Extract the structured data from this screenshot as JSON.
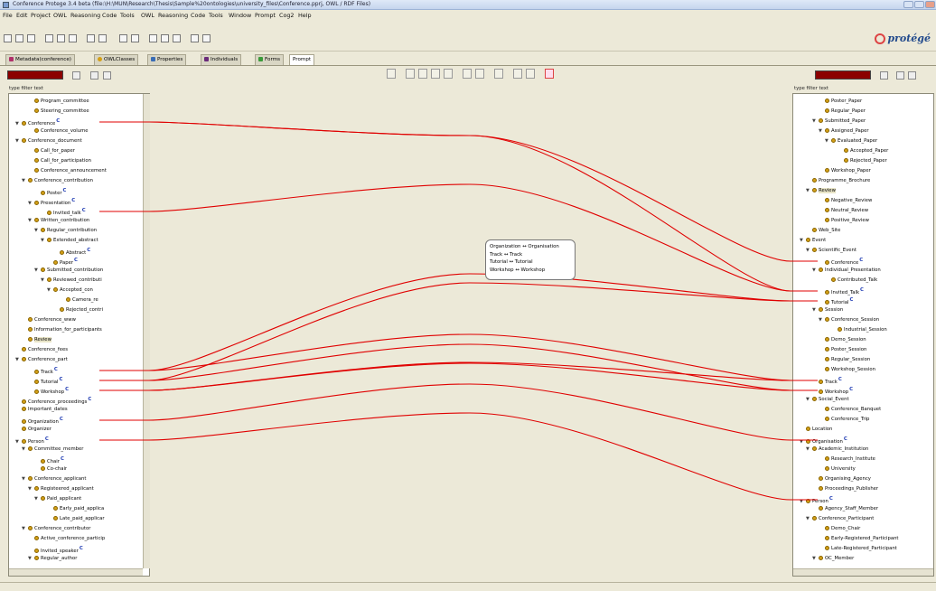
{
  "window": {
    "title": "Conference Protege 3.4 beta   (file:\\H:\\MUN\\Research\\Thesis\\Sample%20ontologies\\university_files\\Conference.pprj, OWL / RDF Files)"
  },
  "menu": [
    "File",
    "Edit",
    "Project",
    "OWL",
    "Reasoning",
    "Code",
    "Tools",
    "OWL",
    "Reasoning",
    "Code",
    "Tools",
    "Window",
    "Prompt",
    "Cog2",
    "Help"
  ],
  "logo": "protégé",
  "tabs": [
    "Metadata(conference)",
    "OWLClasses",
    "Properties",
    "Individuals",
    "Forms",
    "Prompt"
  ],
  "left_panel": {
    "filter_label": "type filter text",
    "rows": [
      {
        "label": "Program_committee",
        "indent": 3,
        "tw": ""
      },
      {
        "label": "Steering_committee",
        "indent": 3,
        "tw": ""
      },
      {
        "label": "Conference",
        "indent": 1,
        "tw": "▼",
        "c": true
      },
      {
        "label": "Conference_volume",
        "indent": 3,
        "tw": ""
      },
      {
        "label": "Conference_document",
        "indent": 1,
        "tw": "▼"
      },
      {
        "label": "Call_for_paper",
        "indent": 3,
        "tw": ""
      },
      {
        "label": "Call_for_participation",
        "indent": 3,
        "tw": ""
      },
      {
        "label": "Conference_announcement",
        "indent": 3,
        "tw": ""
      },
      {
        "label": "Conference_contribution",
        "indent": 2,
        "tw": "▼"
      },
      {
        "label": "Poster",
        "indent": 4,
        "tw": "",
        "c": true
      },
      {
        "label": "Presentation",
        "indent": 3,
        "tw": "▼",
        "c": true
      },
      {
        "label": "Invited_talk",
        "indent": 5,
        "tw": "",
        "c": true
      },
      {
        "label": "Written_contribution",
        "indent": 3,
        "tw": "▼"
      },
      {
        "label": "Regular_contribution",
        "indent": 4,
        "tw": "▼"
      },
      {
        "label": "Extended_abstract",
        "indent": 5,
        "tw": "▼"
      },
      {
        "label": "Abstract",
        "indent": 7,
        "tw": "",
        "c": true
      },
      {
        "label": "Paper",
        "indent": 6,
        "tw": "",
        "c": true
      },
      {
        "label": "Submitted_contribution",
        "indent": 4,
        "tw": "▼"
      },
      {
        "label": "Reviewed_contributi",
        "indent": 5,
        "tw": "▼"
      },
      {
        "label": "Accepted_con",
        "indent": 6,
        "tw": "▼"
      },
      {
        "label": "Camera_re",
        "indent": 8,
        "tw": ""
      },
      {
        "label": "Rejected_contri",
        "indent": 7,
        "tw": ""
      },
      {
        "label": "Conference_www",
        "indent": 2,
        "tw": ""
      },
      {
        "label": "Information_for_participants",
        "indent": 2,
        "tw": ""
      },
      {
        "label": "Review",
        "indent": 2,
        "tw": "",
        "sel": true
      },
      {
        "label": "Conference_fees",
        "indent": 1,
        "tw": ""
      },
      {
        "label": "Conference_part",
        "indent": 1,
        "tw": "▼"
      },
      {
        "label": "Track",
        "indent": 3,
        "tw": "",
        "c": true
      },
      {
        "label": "Tutorial",
        "indent": 3,
        "tw": "",
        "c": true
      },
      {
        "label": "Workshop",
        "indent": 3,
        "tw": "",
        "c": true
      },
      {
        "label": "Conference_proceedings",
        "indent": 1,
        "tw": "",
        "c": true
      },
      {
        "label": "Important_dates",
        "indent": 1,
        "tw": ""
      },
      {
        "label": "Organization",
        "indent": 1,
        "tw": "",
        "c": true
      },
      {
        "label": "Organizer",
        "indent": 1,
        "tw": ""
      },
      {
        "label": "Person",
        "indent": 1,
        "tw": "▼",
        "c": true
      },
      {
        "label": "Committee_member",
        "indent": 2,
        "tw": "▼"
      },
      {
        "label": "Chair",
        "indent": 4,
        "tw": "",
        "c": true
      },
      {
        "label": "Co-chair",
        "indent": 4,
        "tw": ""
      },
      {
        "label": "Conference_applicant",
        "indent": 2,
        "tw": "▼"
      },
      {
        "label": "Registeered_applicant",
        "indent": 3,
        "tw": "▼"
      },
      {
        "label": "Paid_applicant",
        "indent": 4,
        "tw": "▼"
      },
      {
        "label": "Early_paid_applica",
        "indent": 6,
        "tw": ""
      },
      {
        "label": "Late_paid_applicar",
        "indent": 6,
        "tw": ""
      },
      {
        "label": "Conference_contributor",
        "indent": 2,
        "tw": "▼"
      },
      {
        "label": "Active_conference_particip",
        "indent": 3,
        "tw": ""
      },
      {
        "label": "Invited_speaker",
        "indent": 3,
        "tw": "",
        "c": true
      },
      {
        "label": "Regular_author",
        "indent": 3,
        "tw": "▼"
      }
    ]
  },
  "right_panel": {
    "filter_label": "type filter text",
    "rows": [
      {
        "label": "Poster_Paper",
        "indent": 4,
        "tw": ""
      },
      {
        "label": "Regular_Paper",
        "indent": 4,
        "tw": ""
      },
      {
        "label": "Submitted_Paper",
        "indent": 3,
        "tw": "▼"
      },
      {
        "label": "Assigned_Paper",
        "indent": 4,
        "tw": "▼"
      },
      {
        "label": "Evaluated_Paper",
        "indent": 5,
        "tw": "▼"
      },
      {
        "label": "Accepted_Paper",
        "indent": 7,
        "tw": ""
      },
      {
        "label": "Rejected_Paper",
        "indent": 7,
        "tw": ""
      },
      {
        "label": "Workshop_Paper",
        "indent": 4,
        "tw": ""
      },
      {
        "label": "Programme_Brochure",
        "indent": 2,
        "tw": ""
      },
      {
        "label": "Review",
        "indent": 2,
        "tw": "▼",
        "sel": true
      },
      {
        "label": "Negative_Review",
        "indent": 4,
        "tw": ""
      },
      {
        "label": "Neutral_Review",
        "indent": 4,
        "tw": ""
      },
      {
        "label": "Positive_Review",
        "indent": 4,
        "tw": ""
      },
      {
        "label": "Web_Site",
        "indent": 2,
        "tw": ""
      },
      {
        "label": "Event",
        "indent": 1,
        "tw": "▼"
      },
      {
        "label": "Scientific_Event",
        "indent": 2,
        "tw": "▼"
      },
      {
        "label": "Conference",
        "indent": 4,
        "tw": "",
        "c": true
      },
      {
        "label": "Individual_Presentation",
        "indent": 3,
        "tw": "▼"
      },
      {
        "label": "Contributed_Talk",
        "indent": 5,
        "tw": ""
      },
      {
        "label": "Invited_Talk",
        "indent": 4,
        "tw": "",
        "c": true
      },
      {
        "label": "Tutorial",
        "indent": 4,
        "tw": "",
        "c": true
      },
      {
        "label": "Session",
        "indent": 3,
        "tw": "▼"
      },
      {
        "label": "Conference_Session",
        "indent": 4,
        "tw": "▼"
      },
      {
        "label": "Industrial_Session",
        "indent": 6,
        "tw": ""
      },
      {
        "label": "Demo_Session",
        "indent": 4,
        "tw": ""
      },
      {
        "label": "Poster_Session",
        "indent": 4,
        "tw": ""
      },
      {
        "label": "Regular_Session",
        "indent": 4,
        "tw": ""
      },
      {
        "label": "Workshop_Session",
        "indent": 4,
        "tw": ""
      },
      {
        "label": "Track",
        "indent": 3,
        "tw": "",
        "c": true
      },
      {
        "label": "Workshop",
        "indent": 3,
        "tw": "",
        "c": true
      },
      {
        "label": "Social_Event",
        "indent": 2,
        "tw": "▼"
      },
      {
        "label": "Conference_Banquet",
        "indent": 4,
        "tw": ""
      },
      {
        "label": "Conference_Trip",
        "indent": 4,
        "tw": ""
      },
      {
        "label": "Location",
        "indent": 1,
        "tw": ""
      },
      {
        "label": "Organisation",
        "indent": 1,
        "tw": "▼",
        "c": true
      },
      {
        "label": "Academic_Institution",
        "indent": 2,
        "tw": "▼"
      },
      {
        "label": "Research_Institute",
        "indent": 4,
        "tw": ""
      },
      {
        "label": "University",
        "indent": 4,
        "tw": ""
      },
      {
        "label": "Organising_Agency",
        "indent": 3,
        "tw": ""
      },
      {
        "label": "Proceedings_Publisher",
        "indent": 3,
        "tw": ""
      },
      {
        "label": "Person",
        "indent": 1,
        "tw": "▼",
        "c": true
      },
      {
        "label": "Agency_Staff_Member",
        "indent": 3,
        "tw": ""
      },
      {
        "label": "Conference_Participant",
        "indent": 2,
        "tw": "▼"
      },
      {
        "label": "Demo_Chair",
        "indent": 4,
        "tw": ""
      },
      {
        "label": "Early-Registered_Participant",
        "indent": 4,
        "tw": ""
      },
      {
        "label": "Late-Registered_Participant",
        "indent": 4,
        "tw": ""
      },
      {
        "label": "OC_Member",
        "indent": 3,
        "tw": "▼"
      }
    ]
  },
  "tooltip": [
    "Organization ↔ Organisation",
    "Track ↔ Track",
    "Tutorial ↔ Tutorial",
    "Workshop ↔ Workshop"
  ],
  "mappings": [
    {
      "from": "Conference",
      "to": "Conference"
    },
    {
      "from": "Invited_talk",
      "to": "Invited_Talk"
    },
    {
      "from": "Conference",
      "to": "Invited_Talk"
    },
    {
      "from": "Track",
      "to": "Track"
    },
    {
      "from": "Track",
      "to": "Tutorial"
    },
    {
      "from": "Tutorial",
      "to": "Tutorial"
    },
    {
      "from": "Tutorial",
      "to": "Workshop"
    },
    {
      "from": "Workshop",
      "to": "Workshop"
    },
    {
      "from": "Workshop",
      "to": "Track"
    },
    {
      "from": "Organization",
      "to": "Organisation"
    },
    {
      "from": "Person",
      "to": "Person"
    }
  ],
  "colors": {
    "mapping_line": "#e00000",
    "class_dot": "#d4a017",
    "panel_header": "#8b0000"
  }
}
